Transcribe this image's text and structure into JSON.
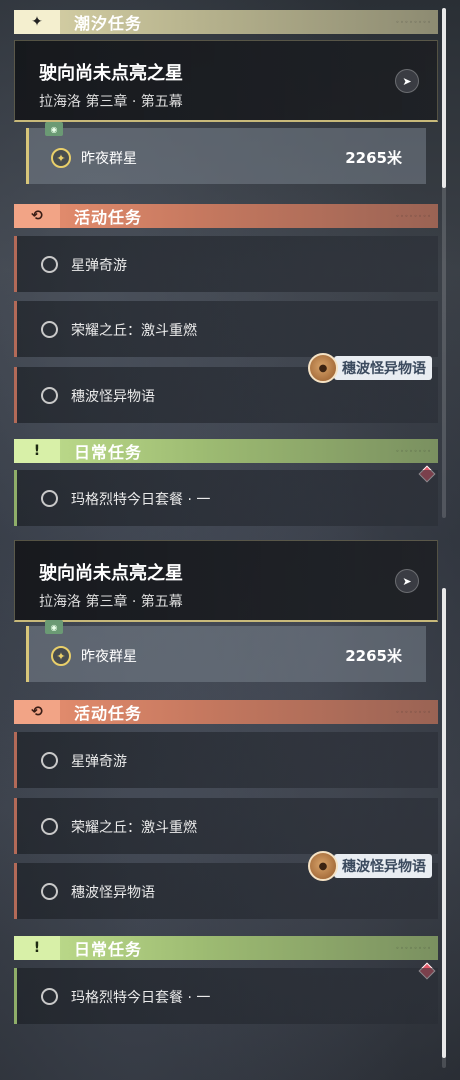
{
  "categories": {
    "tide": {
      "title": "潮汐任务",
      "icon": "sparkle-icon",
      "glyph": "✦"
    },
    "event": {
      "title": "活动任务",
      "icon": "event-refresh-icon",
      "glyph": "⟲"
    },
    "daily": {
      "title": "日常任务",
      "icon": "alert-box-icon",
      "glyph": "!"
    }
  },
  "main_quest": {
    "title": "驶向尚未点亮之星",
    "subtitle": "拉海洛 第三章 · 第五幕",
    "nav_icon": "navigate-arrow-icon"
  },
  "active_task": {
    "name": "昨夜群星",
    "distance": "2265米",
    "tag_icon": "eye-tag-icon",
    "status_icon": "star-target-icon"
  },
  "event_quests": [
    "星弹奇游",
    "荣耀之丘：激斗重燃",
    "穗波怪异物语"
  ],
  "daily_quests": [
    "玛格烈特今日套餐 · 一"
  ],
  "tooltip": {
    "label": "穗波怪异物语",
    "avatar_icon": "capybara-avatar-icon"
  },
  "colors": {
    "tide_accent": "#d9d3a8",
    "event_accent": "#e99070",
    "daily_accent": "#c2e08f",
    "marker": "#e05a6a"
  }
}
